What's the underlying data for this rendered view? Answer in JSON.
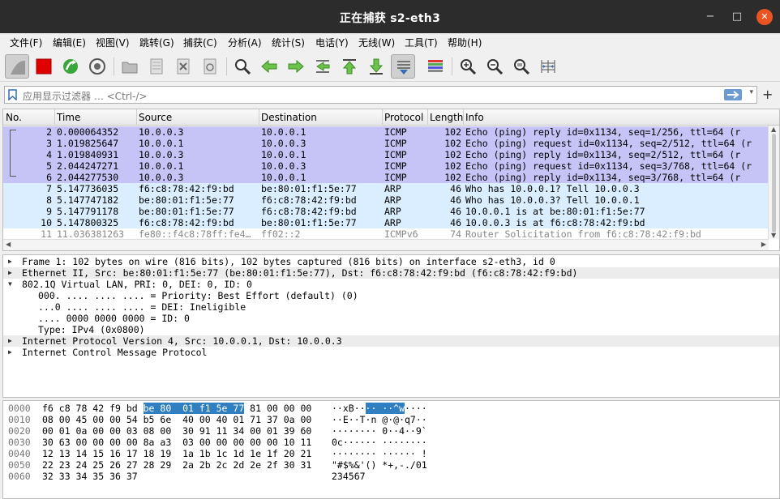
{
  "window": {
    "title": "正在捕获 s2-eth3",
    "min": "−",
    "max": "□",
    "close": "✕"
  },
  "menu": [
    {
      "label": "文件(F)"
    },
    {
      "label": "编辑(E)"
    },
    {
      "label": "视图(V)"
    },
    {
      "label": "跳转(G)"
    },
    {
      "label": "捕获(C)"
    },
    {
      "label": "分析(A)"
    },
    {
      "label": "统计(S)"
    },
    {
      "label": "电话(Y)"
    },
    {
      "label": "无线(W)"
    },
    {
      "label": "工具(T)"
    },
    {
      "label": "帮助(H)"
    }
  ],
  "toolbar": [
    "start-capture-icon",
    "stop-capture-icon",
    "restart-capture-icon",
    "capture-options-icon",
    "open-file-icon",
    "save-file-icon",
    "close-file-icon",
    "reload-file-icon",
    "find-packet-icon",
    "go-back-icon",
    "go-forward-icon",
    "go-to-packet-icon",
    "go-first-icon",
    "go-last-icon",
    "auto-scroll-icon",
    "colorize-icon",
    "zoom-in-icon",
    "zoom-out-icon",
    "zoom-reset-icon",
    "resize-columns-icon"
  ],
  "filter": {
    "placeholder": "应用显示过滤器 … <Ctrl-/>",
    "add": "+",
    "dropdown": "▾"
  },
  "packet_list": {
    "headers": {
      "no": "No.",
      "time": "Time",
      "source": "Source",
      "destination": "Destination",
      "protocol": "Protocol",
      "length": "Length",
      "info": "Info"
    },
    "rows": [
      {
        "no": "2",
        "time": "0.000064352",
        "src": "10.0.0.3",
        "dst": "10.0.0.1",
        "proto": "ICMP",
        "len": "102",
        "info": "Echo (ping) reply    id=0x1134, seq=1/256, ttl=64 (r",
        "kind": "icmp"
      },
      {
        "no": "3",
        "time": "1.019825647",
        "src": "10.0.0.1",
        "dst": "10.0.0.3",
        "proto": "ICMP",
        "len": "102",
        "info": "Echo (ping) request  id=0x1134, seq=2/512, ttl=64 (r",
        "kind": "icmp"
      },
      {
        "no": "4",
        "time": "1.019840931",
        "src": "10.0.0.3",
        "dst": "10.0.0.1",
        "proto": "ICMP",
        "len": "102",
        "info": "Echo (ping) reply    id=0x1134, seq=2/512, ttl=64 (r",
        "kind": "icmp"
      },
      {
        "no": "5",
        "time": "2.044247271",
        "src": "10.0.0.1",
        "dst": "10.0.0.3",
        "proto": "ICMP",
        "len": "102",
        "info": "Echo (ping) request  id=0x1134, seq=3/768, ttl=64 (r",
        "kind": "icmp"
      },
      {
        "no": "6",
        "time": "2.044277530",
        "src": "10.0.0.3",
        "dst": "10.0.0.1",
        "proto": "ICMP",
        "len": "102",
        "info": "Echo (ping) reply    id=0x1134, seq=3/768, ttl=64 (r",
        "kind": "icmp"
      },
      {
        "no": "7",
        "time": "5.147736035",
        "src": "f6:c8:78:42:f9:bd",
        "dst": "be:80:01:f1:5e:77",
        "proto": "ARP",
        "len": "46",
        "info": "Who has 10.0.0.1? Tell 10.0.0.3",
        "kind": "arp"
      },
      {
        "no": "8",
        "time": "5.147747182",
        "src": "be:80:01:f1:5e:77",
        "dst": "f6:c8:78:42:f9:bd",
        "proto": "ARP",
        "len": "46",
        "info": "Who has 10.0.0.3? Tell 10.0.0.1",
        "kind": "arp"
      },
      {
        "no": "9",
        "time": "5.147791178",
        "src": "be:80:01:f1:5e:77",
        "dst": "f6:c8:78:42:f9:bd",
        "proto": "ARP",
        "len": "46",
        "info": "10.0.0.1 is at be:80:01:f1:5e:77",
        "kind": "arp"
      },
      {
        "no": "10",
        "time": "5.147800325",
        "src": "f6:c8:78:42:f9:bd",
        "dst": "be:80:01:f1:5e:77",
        "proto": "ARP",
        "len": "46",
        "info": "10.0.0.3 is at f6:c8:78:42:f9:bd",
        "kind": "arp"
      },
      {
        "no": "11",
        "time": "11.036381263",
        "src": "fe80::f4c8:78ff:fe4…",
        "dst": "ff02::2",
        "proto": "ICMPv6",
        "len": "74",
        "info": "Router Solicitation from f6:c8:78:42:f9:bd",
        "kind": "icmpv6"
      }
    ]
  },
  "details": [
    {
      "text": "Frame 1: 102 bytes on wire (816 bits), 102 bytes captured (816 bits) on interface s2-eth3, id 0",
      "arrow": "▶",
      "alt": false,
      "indent": 0
    },
    {
      "text": "Ethernet II, Src: be:80:01:f1:5e:77 (be:80:01:f1:5e:77), Dst: f6:c8:78:42:f9:bd (f6:c8:78:42:f9:bd)",
      "arrow": "▶",
      "alt": true,
      "indent": 0
    },
    {
      "text": "802.1Q Virtual LAN, PRI: 0, DEI: 0, ID: 0",
      "arrow": "▼",
      "alt": false,
      "indent": 0
    },
    {
      "text": "000. .... .... .... = Priority: Best Effort (default) (0)",
      "arrow": "",
      "alt": false,
      "indent": 1
    },
    {
      "text": "...0 .... .... .... = DEI: Ineligible",
      "arrow": "",
      "alt": false,
      "indent": 1
    },
    {
      "text": ".... 0000 0000 0000 = ID: 0",
      "arrow": "",
      "alt": false,
      "indent": 1
    },
    {
      "text": "Type: IPv4 (0x0800)",
      "arrow": "",
      "alt": false,
      "indent": 1
    },
    {
      "text": "Internet Protocol Version 4, Src: 10.0.0.1, Dst: 10.0.0.3",
      "arrow": "▶",
      "alt": true,
      "indent": 0
    },
    {
      "text": "Internet Control Message Protocol",
      "arrow": "▶",
      "alt": false,
      "indent": 0
    }
  ],
  "hex": [
    {
      "off": "0000",
      "pre": "f6 c8 78 42 f9 bd ",
      "hl": "be 80  01 f1 5e 77",
      "post": " 81 00 00 00",
      "apre": "··xB··",
      "ahl": "·· ··^w",
      "apost": "····"
    },
    {
      "off": "0010",
      "pre": "08 00 45 00 00 54 b5 6e  40 00 40 01 71 37 0a 00",
      "hl": "",
      "post": "",
      "apre": "··E··T·n @·@·q7··",
      "ahl": "",
      "apost": ""
    },
    {
      "off": "0020",
      "pre": "00 01 0a 00 00 03 08 00  30 91 11 34 00 01 39 60",
      "hl": "",
      "post": "",
      "apre": "········ 0··4··9`",
      "ahl": "",
      "apost": ""
    },
    {
      "off": "0030",
      "pre": "30 63 00 00 00 00 8a a3  03 00 00 00 00 00 10 11",
      "hl": "",
      "post": "",
      "apre": "0c······ ········",
      "ahl": "",
      "apost": ""
    },
    {
      "off": "0040",
      "pre": "12 13 14 15 16 17 18 19  1a 1b 1c 1d 1e 1f 20 21",
      "hl": "",
      "post": "",
      "apre": "········ ······ !",
      "ahl": "",
      "apost": ""
    },
    {
      "off": "0050",
      "pre": "22 23 24 25 26 27 28 29  2a 2b 2c 2d 2e 2f 30 31",
      "hl": "",
      "post": "",
      "apre": "\"#$%&'() *+,-./01",
      "ahl": "",
      "apost": ""
    },
    {
      "off": "0060",
      "pre": "32 33 34 35 36 37",
      "hl": "",
      "post": "",
      "apre": "234567",
      "ahl": "",
      "apost": ""
    }
  ],
  "colors": {
    "icmp_row": "#c6c3f7",
    "arp_row": "#daeeff",
    "highlight": "#2f7fc1",
    "titlebar": "#2c2c2c",
    "close_button": "#e95420"
  }
}
